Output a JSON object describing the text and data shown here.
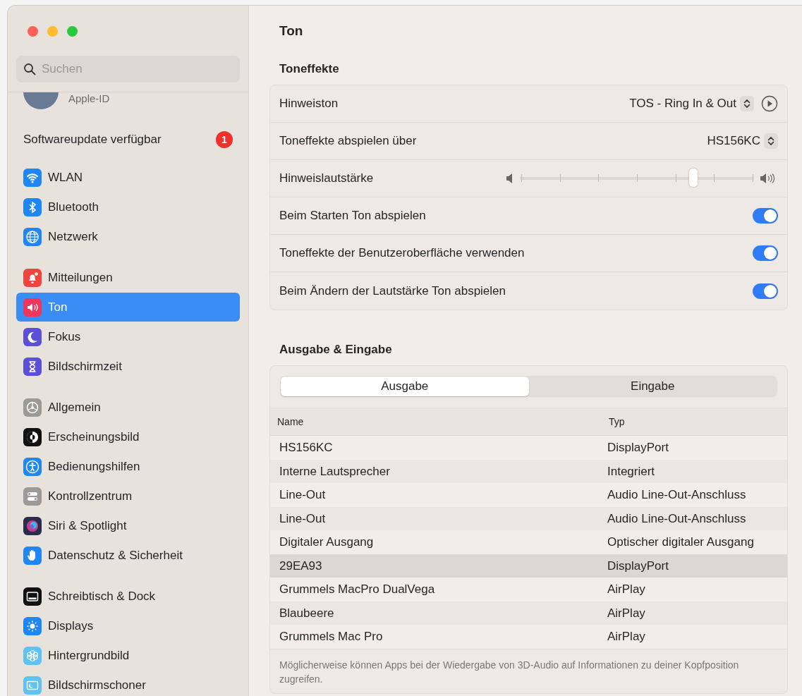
{
  "sidebar": {
    "search": {
      "placeholder": "Suchen"
    },
    "account": {
      "label": "Apple-ID"
    },
    "update": {
      "label": "Softwareupdate verfügbar",
      "badge": "1"
    },
    "groups": [
      [
        {
          "label": "WLAN",
          "kind": "wifi",
          "selected": false
        },
        {
          "label": "Bluetooth",
          "kind": "bluetooth",
          "selected": false
        },
        {
          "label": "Netzwerk",
          "kind": "globe",
          "selected": false
        }
      ],
      [
        {
          "label": "Mitteilungen",
          "kind": "bell",
          "selected": false
        },
        {
          "label": "Ton",
          "kind": "speaker",
          "selected": true
        },
        {
          "label": "Fokus",
          "kind": "moon",
          "selected": false
        },
        {
          "label": "Bildschirmzeit",
          "kind": "hourglass",
          "selected": false
        }
      ],
      [
        {
          "label": "Allgemein",
          "kind": "gear",
          "selected": false
        },
        {
          "label": "Erscheinungsbild",
          "kind": "appearance",
          "selected": false
        },
        {
          "label": "Bedienungshilfen",
          "kind": "accessibility",
          "selected": false
        },
        {
          "label": "Kontrollzentrum",
          "kind": "switches",
          "selected": false
        },
        {
          "label": "Siri & Spotlight",
          "kind": "orb",
          "selected": false
        },
        {
          "label": "Datenschutz & Sicherheit",
          "kind": "hand",
          "selected": false
        }
      ],
      [
        {
          "label": "Schreibtisch & Dock",
          "kind": "dock",
          "selected": false
        },
        {
          "label": "Displays",
          "kind": "sun",
          "selected": false
        },
        {
          "label": "Hintergrundbild",
          "kind": "flower",
          "selected": false
        },
        {
          "label": "Bildschirmschoner",
          "kind": "screensaver",
          "selected": false
        }
      ]
    ]
  },
  "page": {
    "title": "Ton"
  },
  "sound_effects": {
    "heading": "Toneffekte",
    "rows": [
      {
        "kind": "popup-play",
        "label": "Hinweiston",
        "value": "TOS - Ring In & Out"
      },
      {
        "kind": "popup",
        "label": "Toneffekte abspielen über",
        "value": "HS156KC"
      },
      {
        "kind": "slider",
        "label": "Hinweislautstärke",
        "level": 0.74
      },
      {
        "kind": "toggle",
        "label": "Beim Starten Ton abspielen",
        "checked": true
      },
      {
        "kind": "toggle",
        "label": "Toneffekte der Benutzeroberfläche verwenden",
        "checked": true
      },
      {
        "kind": "toggle",
        "label": "Beim Ändern der Lautstärke Ton abspielen",
        "checked": true
      }
    ]
  },
  "output_input": {
    "heading": "Ausgabe & Eingabe",
    "tabs": [
      {
        "label": "Ausgabe",
        "selected": true
      },
      {
        "label": "Eingabe",
        "selected": false
      }
    ],
    "columns": [
      "Name",
      "Typ"
    ],
    "rows": [
      {
        "name": "HS156KC",
        "type": "DisplayPort",
        "selected": false
      },
      {
        "name": "Interne Lautsprecher",
        "type": "Integriert",
        "selected": false
      },
      {
        "name": "Line-Out",
        "type": "Audio Line-Out-Anschluss",
        "selected": false
      },
      {
        "name": "Line-Out",
        "type": "Audio Line-Out-Anschluss",
        "selected": false
      },
      {
        "name": "Digitaler Ausgang",
        "type": "Optischer digitaler Ausgang",
        "selected": false
      },
      {
        "name": "29EA93",
        "type": "DisplayPort",
        "selected": true
      },
      {
        "name": "Grummels MacPro DualVega",
        "type": "AirPlay",
        "selected": false
      },
      {
        "name": "Blaubeere",
        "type": "AirPlay",
        "selected": false
      },
      {
        "name": "Grummels Mac Pro",
        "type": "AirPlay",
        "selected": false
      }
    ],
    "note": "Möglicherweise können Apps bei der Wiedergabe von 3D-Audio auf Informationen zu deiner Kopfposition zugreifen."
  }
}
